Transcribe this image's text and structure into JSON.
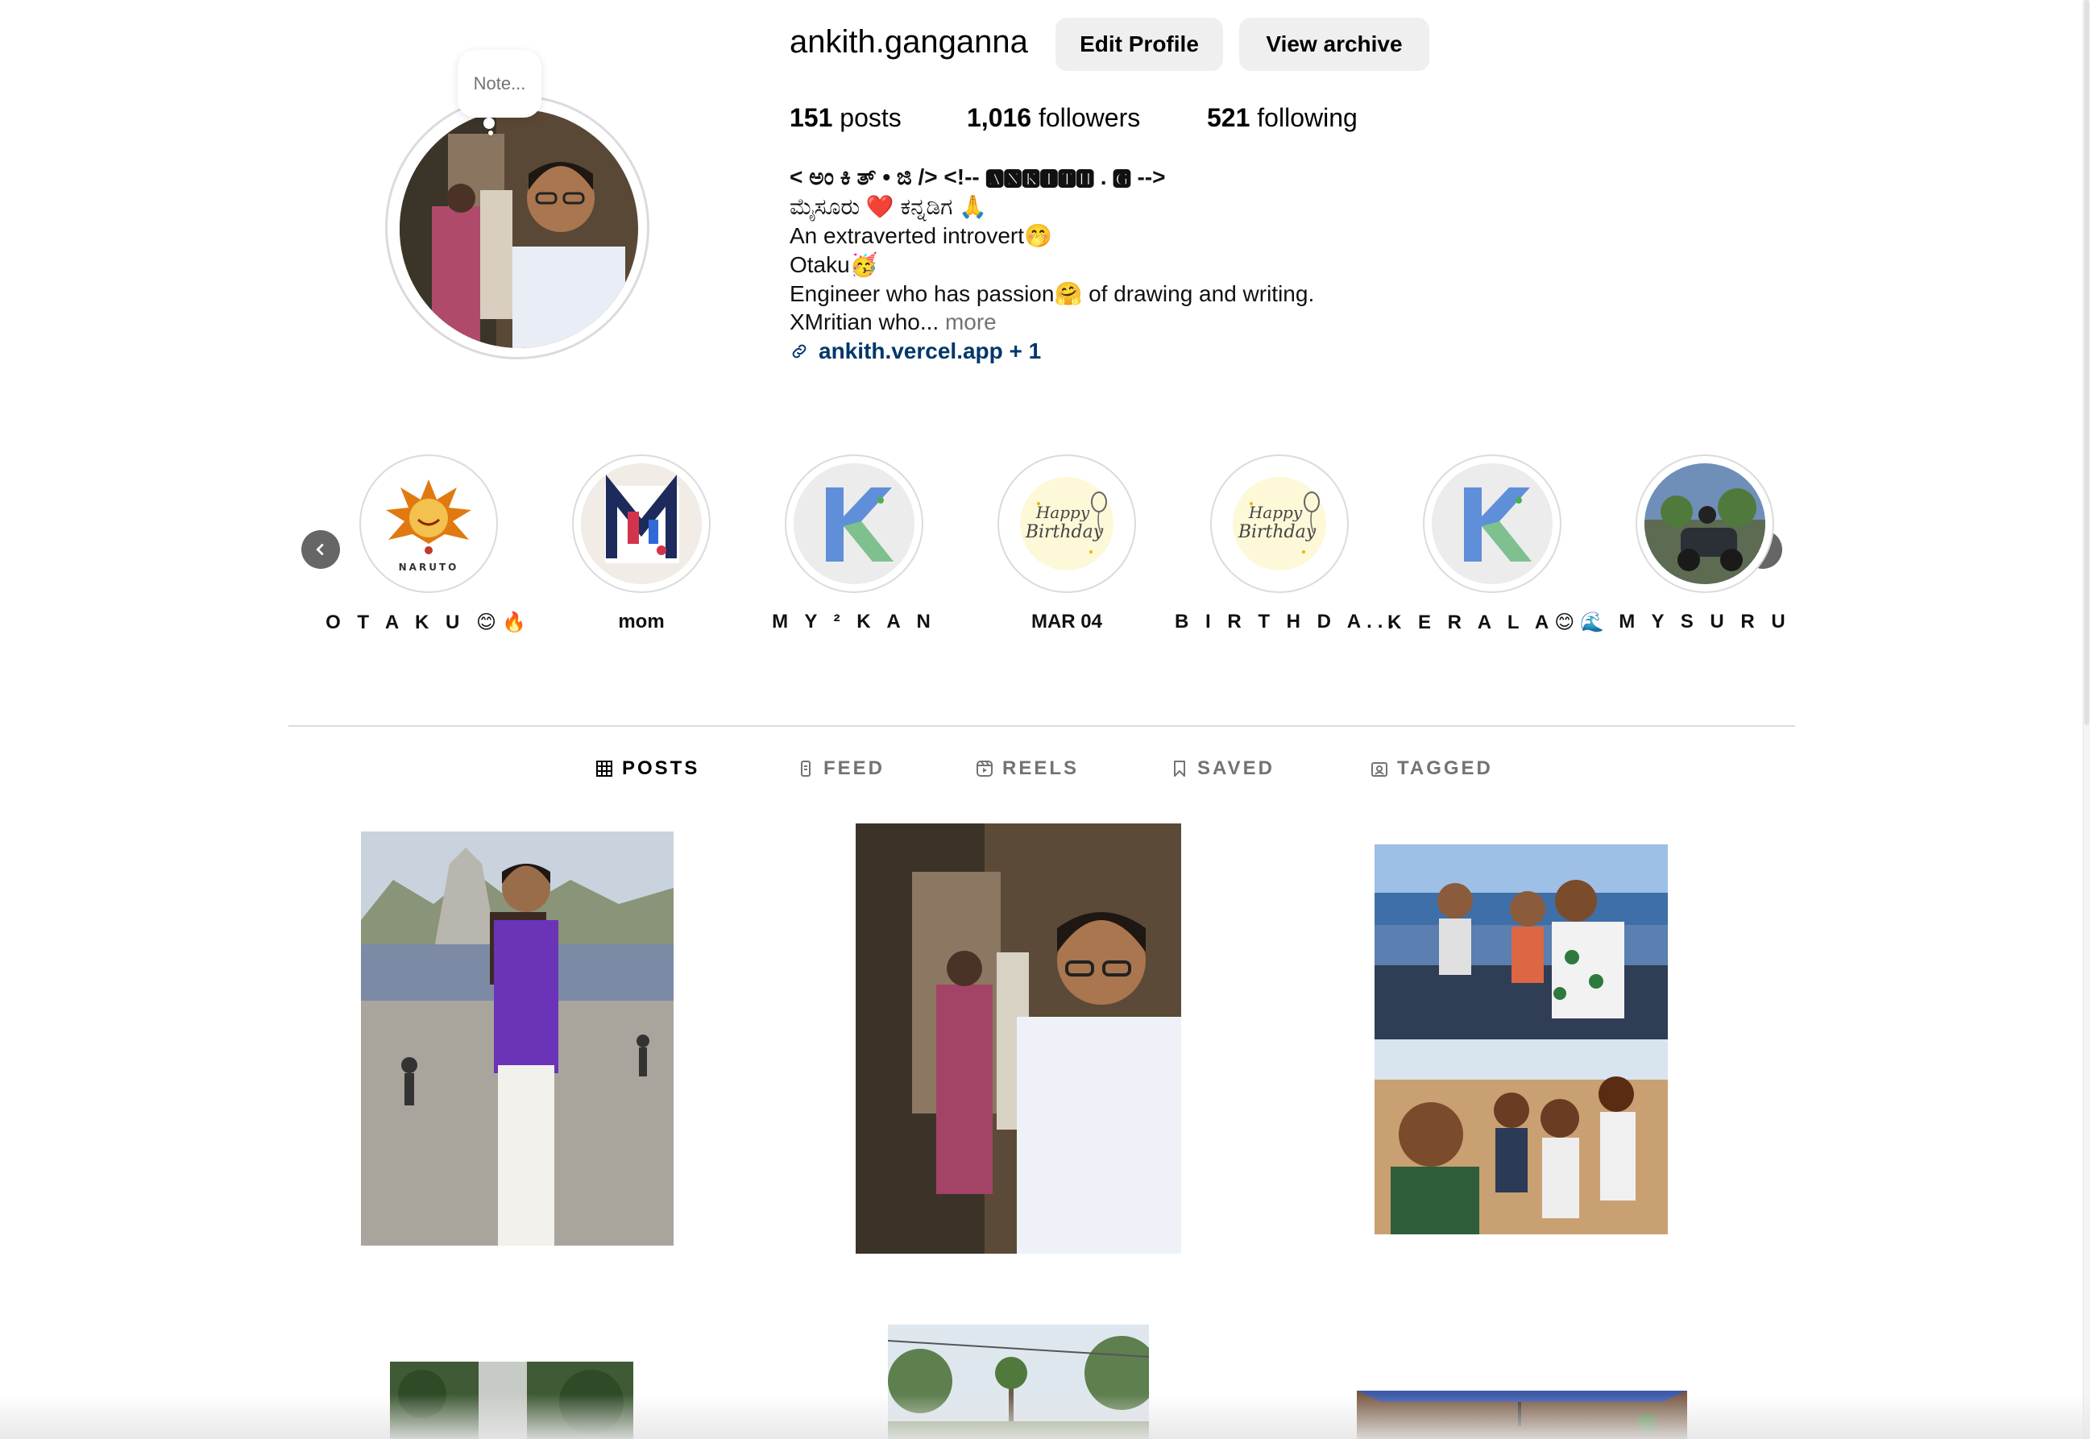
{
  "profile": {
    "username": "ankith.ganganna",
    "note_placeholder": "Note...",
    "buttons": {
      "edit": "Edit Profile",
      "archive": "View archive"
    },
    "stats": {
      "posts_count": "151",
      "posts_label": "posts",
      "followers_count": "1,016",
      "followers_label": "followers",
      "following_count": "521",
      "following_label": "following"
    },
    "bio": {
      "line1": "< ಅಂ ಕಿ ತ್ • ಜಿ /> <!-- 🅰🅽🅺🅸🆃🅷 . 🅶 -->",
      "line2": "ಮೈಸೂರು ❤️ ಕನ್ನಡಿಗ 🙏",
      "line3": "An extraverted introvert🤭",
      "line4": "Otaku🥳",
      "line5": "Engineer who has passion🤗 of drawing and writing.",
      "line6": "XMritian who...",
      "more": "more",
      "link": "ankith.vercel.app + 1"
    }
  },
  "highlights": [
    {
      "label": "O T A K U 😊🔥",
      "icon": "naruto-logo"
    },
    {
      "label": "mom",
      "icon": "letter-m"
    },
    {
      "label": "M Y ² K A N",
      "icon": "letter-k"
    },
    {
      "label": "MAR 04",
      "icon": "happy-birthday"
    },
    {
      "label": "B I R T H D A...",
      "icon": "happy-birthday"
    },
    {
      "label": "K E R A L A😊🌊",
      "icon": "letter-k"
    },
    {
      "label": "M Y S U R U",
      "icon": "bike-photo"
    }
  ],
  "tabs": [
    {
      "label": "POSTS",
      "icon": "grid-icon",
      "active": true
    },
    {
      "label": "FEED",
      "icon": "phone-icon",
      "active": false
    },
    {
      "label": "REELS",
      "icon": "reels-icon",
      "active": false
    },
    {
      "label": "SAVED",
      "icon": "bookmark-icon",
      "active": false
    },
    {
      "label": "TAGGED",
      "icon": "tag-person-icon",
      "active": false
    }
  ],
  "colors": {
    "link": "#00376b",
    "button_bg": "#efefef",
    "muted": "#737373",
    "border": "#dbdbdb"
  }
}
